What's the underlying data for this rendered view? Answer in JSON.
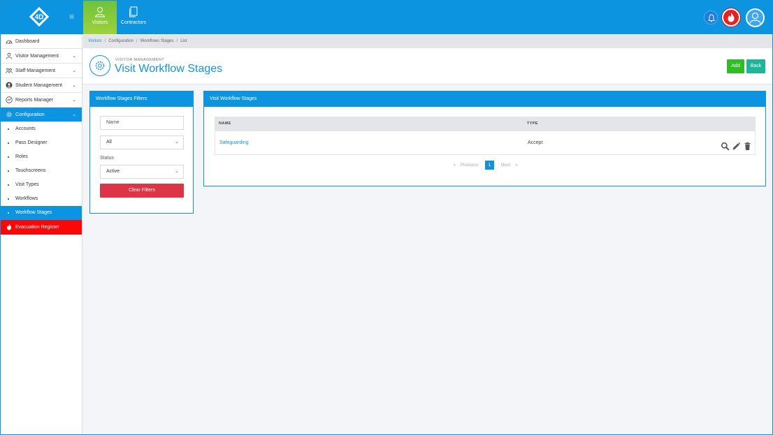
{
  "topbar": {
    "logo_text": "4D",
    "tabs": [
      {
        "label": "Visitors",
        "icon": "user-icon",
        "active": true
      },
      {
        "label": "Contractors",
        "icon": "documents-icon",
        "active": false
      }
    ]
  },
  "sidebar": {
    "items": [
      {
        "label": "Dashboard",
        "icon": "dashboard-icon"
      },
      {
        "label": "Visitor Management",
        "icon": "user-icon"
      },
      {
        "label": "Staff Management",
        "icon": "group-icon"
      },
      {
        "label": "Student Management",
        "icon": "student-icon"
      },
      {
        "label": "Reports Manager",
        "icon": "chart-icon"
      },
      {
        "label": "Configuration",
        "icon": "gear-icon"
      }
    ],
    "sub_items": [
      {
        "label": "Accounts"
      },
      {
        "label": "Pass Designer"
      },
      {
        "label": "Roles"
      },
      {
        "label": "Touchscreens"
      },
      {
        "label": "Visit Types"
      },
      {
        "label": "Workflows"
      },
      {
        "label": "Workflow Stages"
      }
    ],
    "evacuation": {
      "label": "Evacuation Register",
      "icon": "fire-icon"
    }
  },
  "breadcrumb": [
    "Visitors",
    "Configuration",
    "Workflows Stages",
    "List"
  ],
  "header": {
    "subtitle": "VISITOR MANAGEMENT",
    "title": "Visit Workflow Stages",
    "add_label": "Add",
    "back_label": "Back"
  },
  "filters": {
    "title": "Workflow Stages Filters",
    "name_placeholder": "Name",
    "type_value": "All",
    "status_label": "Status",
    "status_value": "Active",
    "clear_label": "Clear Filters"
  },
  "table": {
    "title": "Visit Workflow Stages",
    "columns": [
      "NAME",
      "TYPE"
    ],
    "rows": [
      {
        "name": "Safeguarding",
        "type": "Accept"
      }
    ]
  },
  "pager": {
    "previous": "Previous",
    "current": "1",
    "next": "Next",
    "prev_glyph": "«",
    "next_glyph": "»"
  },
  "colors": {
    "primary": "#0d94e0",
    "visitors_tab": "#9fd23c",
    "add": "#2ebd25",
    "back": "#1fb59b",
    "clear": "#dd3545",
    "evacuation": "#fc0707"
  }
}
